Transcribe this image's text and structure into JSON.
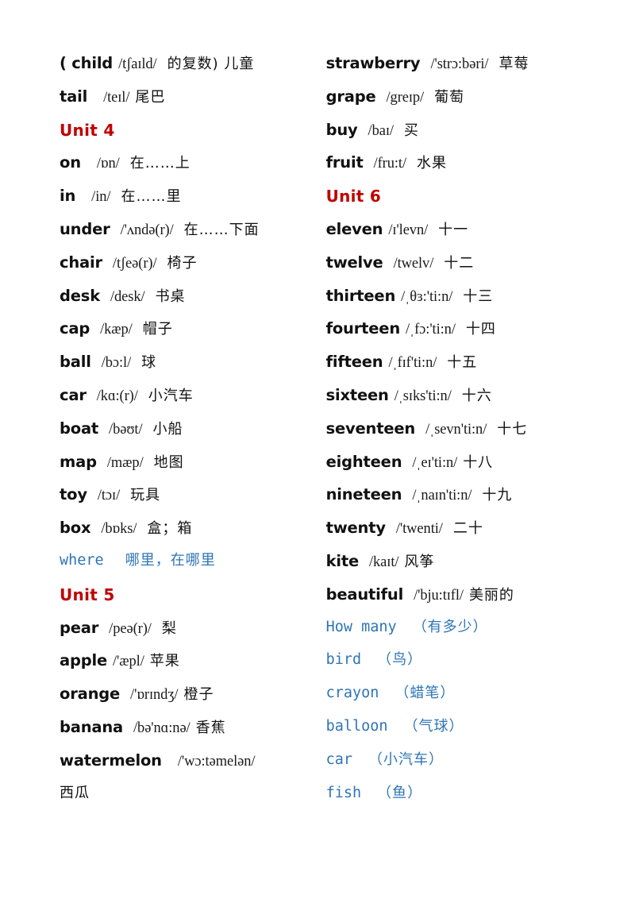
{
  "document": {
    "type": "vocabulary-list",
    "title_visible": false,
    "colors": {
      "unit_heading": "#C00000",
      "blue_entry": "#2E75B6",
      "body_text": "#111111",
      "page_background": "#FFFFFF"
    }
  },
  "left_column": {
    "entries": [
      {
        "id": "children-continued",
        "kind": "word",
        "word": "( child",
        "phonetic": "/tʃaɪld/",
        "chinese": "的复数) 儿童",
        "style": "black"
      },
      {
        "id": "tail",
        "kind": "word",
        "word": "tail",
        "phonetic": "/teɪl/",
        "chinese": "尾巴",
        "style": "black"
      },
      {
        "id": "unit-4",
        "kind": "heading",
        "label": "Unit 4"
      },
      {
        "id": "on",
        "kind": "word",
        "word": "on",
        "phonetic": "/ɒn/",
        "chinese": "在……上",
        "style": "black"
      },
      {
        "id": "in",
        "kind": "word",
        "word": "in",
        "phonetic": "/in/",
        "chinese": "在……里",
        "style": "black"
      },
      {
        "id": "under",
        "kind": "word",
        "word": "under",
        "phonetic": "/'ʌndə(r)/",
        "chinese": "在……下面",
        "style": "black"
      },
      {
        "id": "chair",
        "kind": "word",
        "word": "chair",
        "phonetic": "/tʃeə(r)/",
        "chinese": "椅子",
        "style": "black"
      },
      {
        "id": "desk",
        "kind": "word",
        "word": "desk",
        "phonetic": "/desk/",
        "chinese": "书桌",
        "style": "black"
      },
      {
        "id": "cap",
        "kind": "word",
        "word": "cap",
        "phonetic": "/kæp/",
        "chinese": "帽子",
        "style": "black"
      },
      {
        "id": "ball",
        "kind": "word",
        "word": "ball",
        "phonetic": "/bɔ:l/",
        "chinese": "球",
        "style": "black"
      },
      {
        "id": "car",
        "kind": "word",
        "word": "car",
        "phonetic": "/kɑ:(r)/",
        "chinese": "小汽车",
        "style": "black"
      },
      {
        "id": "boat",
        "kind": "word",
        "word": "boat",
        "phonetic": "/bəʊt/",
        "chinese": "小船",
        "style": "black"
      },
      {
        "id": "map",
        "kind": "word",
        "word": "map",
        "phonetic": "/mæp/",
        "chinese": "地图",
        "style": "black"
      },
      {
        "id": "toy",
        "kind": "word",
        "word": "toy",
        "phonetic": "/tɔɪ/",
        "chinese": "玩具",
        "style": "black"
      },
      {
        "id": "box",
        "kind": "word",
        "word": "box",
        "phonetic": "/bɒks/",
        "chinese": "盒；箱",
        "style": "black"
      },
      {
        "id": "where",
        "kind": "word",
        "word": "where",
        "phonetic": "",
        "chinese": "哪里，在哪里",
        "style": "blue"
      },
      {
        "id": "unit-5",
        "kind": "heading",
        "label": "Unit 5"
      },
      {
        "id": "pear",
        "kind": "word",
        "word": "pear",
        "phonetic": "/peə(r)/",
        "chinese": "梨",
        "style": "black"
      },
      {
        "id": "apple",
        "kind": "word",
        "word": "apple",
        "phonetic": "/'æpl/",
        "chinese": "苹果",
        "style": "black"
      },
      {
        "id": "orange",
        "kind": "word",
        "word": "orange",
        "phonetic": "/'ɒrɪndʒ/",
        "chinese": "橙子",
        "style": "black"
      },
      {
        "id": "banana",
        "kind": "word",
        "word": "banana",
        "phonetic": "/bə'nɑ:nə/",
        "chinese": "香蕉",
        "style": "black"
      },
      {
        "id": "watermelon",
        "kind": "word-wrapped",
        "word": "watermelon",
        "phonetic": "/'wɔ:təmelən/",
        "chinese": "西瓜",
        "style": "black"
      }
    ]
  },
  "right_column": {
    "entries": [
      {
        "id": "strawberry",
        "kind": "word",
        "word": "strawberry",
        "phonetic": "/'strɔ:bəri/",
        "chinese": "草莓",
        "style": "black"
      },
      {
        "id": "grape",
        "kind": "word",
        "word": "grape",
        "phonetic": "/greɪp/",
        "chinese": "葡萄",
        "style": "black"
      },
      {
        "id": "buy",
        "kind": "word",
        "word": "buy",
        "phonetic": "/baɪ/",
        "chinese": "买",
        "style": "black"
      },
      {
        "id": "fruit",
        "kind": "word",
        "word": "fruit",
        "phonetic": "/fru:t/",
        "chinese": "水果",
        "style": "black"
      },
      {
        "id": "unit-6",
        "kind": "heading",
        "label": "Unit 6"
      },
      {
        "id": "eleven",
        "kind": "word",
        "word": "eleven",
        "phonetic": "/ɪ'levn/",
        "chinese": "十一",
        "style": "black"
      },
      {
        "id": "twelve",
        "kind": "word",
        "word": "twelve",
        "phonetic": "/twelv/",
        "chinese": "十二",
        "style": "black"
      },
      {
        "id": "thirteen",
        "kind": "word",
        "word": "thirteen",
        "phonetic": "/ˌθɜ:'ti:n/",
        "chinese": "十三",
        "style": "black"
      },
      {
        "id": "fourteen",
        "kind": "word",
        "word": "fourteen",
        "phonetic": "/ˌfɔ:'ti:n/",
        "chinese": "十四",
        "style": "black"
      },
      {
        "id": "fifteen",
        "kind": "word",
        "word": "fifteen",
        "phonetic": "/ˌfɪf'ti:n/",
        "chinese": "十五",
        "style": "black"
      },
      {
        "id": "sixteen",
        "kind": "word",
        "word": "sixteen",
        "phonetic": "/ˌsɪks'ti:n/",
        "chinese": "十六",
        "style": "black"
      },
      {
        "id": "seventeen",
        "kind": "word",
        "word": "seventeen",
        "phonetic": "/ˌsevn'ti:n/",
        "chinese": "十七",
        "style": "black"
      },
      {
        "id": "eighteen",
        "kind": "word",
        "word": "eighteen",
        "phonetic": "/ˌeɪ'ti:n/",
        "chinese": "十八",
        "style": "black"
      },
      {
        "id": "nineteen",
        "kind": "word",
        "word": "nineteen",
        "phonetic": "/ˌnaɪn'ti:n/",
        "chinese": "十九",
        "style": "black"
      },
      {
        "id": "twenty",
        "kind": "word",
        "word": "twenty",
        "phonetic": "/'twenti/",
        "chinese": "二十",
        "style": "black"
      },
      {
        "id": "kite",
        "kind": "word",
        "word": "kite",
        "phonetic": "/kaɪt/",
        "chinese": "风筝",
        "style": "black"
      },
      {
        "id": "beautiful",
        "kind": "word",
        "word": "beautiful",
        "phonetic": "/'bju:tɪfl/",
        "chinese": "美丽的",
        "style": "black"
      },
      {
        "id": "how-many",
        "kind": "word",
        "word": "How many",
        "phonetic": "",
        "chinese": "（有多少）",
        "style": "blue"
      },
      {
        "id": "bird",
        "kind": "word",
        "word": "bird",
        "phonetic": "",
        "chinese": "（鸟）",
        "style": "blue"
      },
      {
        "id": "crayon",
        "kind": "word",
        "word": "crayon",
        "phonetic": "",
        "chinese": "（蜡笔）",
        "style": "blue"
      },
      {
        "id": "balloon",
        "kind": "word",
        "word": "balloon",
        "phonetic": "",
        "chinese": "（气球）",
        "style": "blue"
      },
      {
        "id": "car-blue",
        "kind": "word",
        "word": "car",
        "phonetic": "",
        "chinese": "（小汽车）",
        "style": "blue"
      },
      {
        "id": "fish",
        "kind": "word",
        "word": "fish",
        "phonetic": "",
        "chinese": "（鱼）",
        "style": "blue"
      }
    ]
  }
}
